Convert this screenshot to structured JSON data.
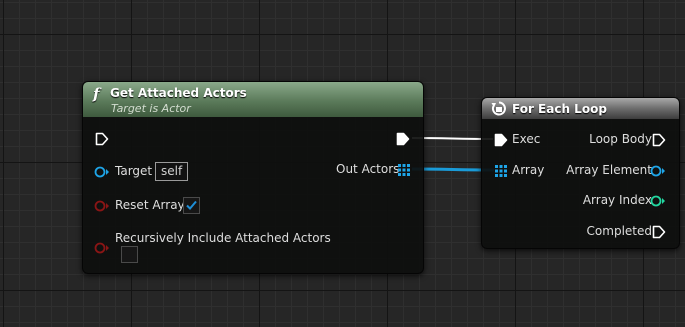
{
  "get_attached_node": {
    "icon": "f",
    "title": "Get Attached Actors",
    "subtitle": "Target is Actor",
    "target_label": "Target",
    "target_value": "self",
    "reset_array_label": "Reset Array",
    "reset_array_checked": true,
    "recursive_label": "Recursively Include Attached Actors",
    "recursive_checked": false,
    "out_actors_label": "Out Actors"
  },
  "foreach_node": {
    "title": "For Each Loop",
    "exec_label": "Exec",
    "array_label": "Array",
    "loop_body_label": "Loop Body",
    "array_element_label": "Array Element",
    "array_index_label": "Array Index",
    "completed_label": "Completed"
  },
  "colors": {
    "exec_wire": "#ffffff",
    "object_wire": "#1a9bd8",
    "object_pin": "#1ea5e8",
    "bool_pin": "#8a1515",
    "int_pin": "#22d6a0",
    "checkmark": "#1e8fd8",
    "function_header": "#5b7a5a",
    "macro_header": "#6d6d6d"
  }
}
